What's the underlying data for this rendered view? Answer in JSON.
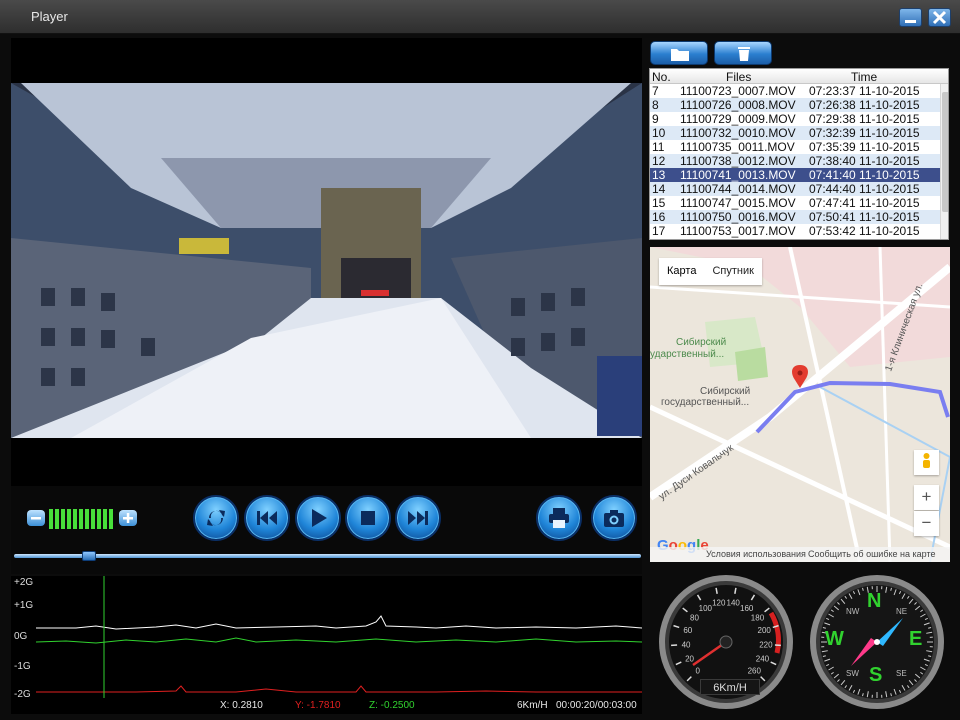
{
  "window": {
    "title": "Player"
  },
  "toolbar": {
    "open_icon": "folder-icon",
    "delete_icon": "trash-icon"
  },
  "file_list": {
    "columns": [
      "No.",
      "Files",
      "Time"
    ],
    "rows": [
      {
        "no": "7",
        "file": "11100723_0007.MOV",
        "time": "07:23:37 11-10-2015"
      },
      {
        "no": "8",
        "file": "11100726_0008.MOV",
        "time": "07:26:38 11-10-2015"
      },
      {
        "no": "9",
        "file": "11100729_0009.MOV",
        "time": "07:29:38 11-10-2015"
      },
      {
        "no": "10",
        "file": "11100732_0010.MOV",
        "time": "07:32:39 11-10-2015"
      },
      {
        "no": "11",
        "file": "11100735_0011.MOV",
        "time": "07:35:39 11-10-2015"
      },
      {
        "no": "12",
        "file": "11100738_0012.MOV",
        "time": "07:38:40 11-10-2015"
      },
      {
        "no": "13",
        "file": "11100741_0013.MOV",
        "time": "07:41:40 11-10-2015"
      },
      {
        "no": "14",
        "file": "11100744_0014.MOV",
        "time": "07:44:40 11-10-2015"
      },
      {
        "no": "15",
        "file": "11100747_0015.MOV",
        "time": "07:47:41 11-10-2015"
      },
      {
        "no": "16",
        "file": "11100750_0016.MOV",
        "time": "07:50:41 11-10-2015"
      },
      {
        "no": "17",
        "file": "11100753_0017.MOV",
        "time": "07:53:42 11-10-2015"
      }
    ],
    "selected_no": "13"
  },
  "map": {
    "tabs": [
      "Карта",
      "Спутник"
    ],
    "labels": {
      "uni1": "Сибирский",
      "uni1b": "ударственный...",
      "uni2": "Сибирский",
      "uni2b": "государственный...",
      "street1": "ул. Дуси Ковальчук",
      "street2": "1-я Клиническая ул."
    },
    "zoom_in": "+",
    "zoom_out": "−",
    "logo": "Google",
    "footer_terms": "Условия использования",
    "footer_report": "Сообщить об ошибке на карте"
  },
  "graph": {
    "y_labels": [
      "+2G",
      "+1G",
      "0G",
      "-1G",
      "-2G"
    ],
    "x_value": "X: 0.2810",
    "y_value": "Y: -1.7810",
    "z_value": "Z: -0.2500",
    "speed": "6Km/H",
    "time": "00:00:20/00:03:00"
  },
  "playback": {
    "volume_level": 1.0,
    "seek_fraction": 0.111
  },
  "speedometer": {
    "ticks": [
      "0",
      "20",
      "40",
      "60",
      "80",
      "100",
      "120",
      "140",
      "160",
      "180",
      "200",
      "220",
      "240",
      "260"
    ],
    "readout": "6Km/H"
  },
  "compass": {
    "letters": [
      "N",
      "E",
      "S",
      "W"
    ],
    "minor": [
      "NE",
      "SE",
      "SW",
      "NW"
    ]
  },
  "colors": {
    "accent": "#2b7fd0",
    "graph_x": "#ffffff",
    "graph_y": "#e02020",
    "graph_z": "#31d22f",
    "selected_row": "#3d4f8c"
  }
}
